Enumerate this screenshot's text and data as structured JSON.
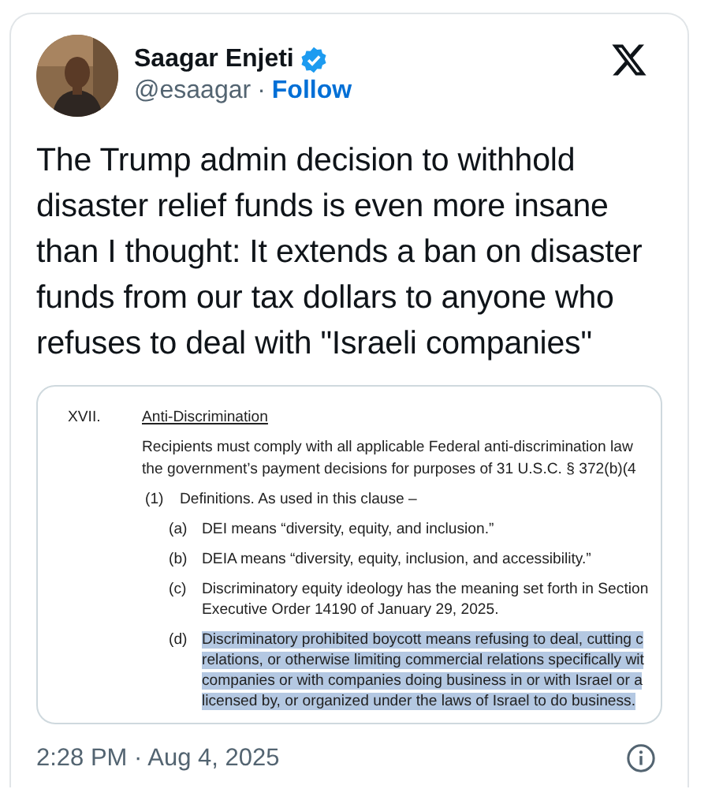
{
  "author": {
    "name": "Saagar Enjeti",
    "verified": true,
    "handle": "@esaagar",
    "separator": "·",
    "follow": "Follow"
  },
  "text": "The Trump admin decision to withhold disaster relief funds is even more insane than I thought: It extends a ban on disaster funds from our tax dollars to anyone who refuses to deal with \"Israeli companies\"",
  "document": {
    "section_number": "XVII.",
    "heading": "Anti-Discrimination",
    "intro_lines": [
      "Recipients must comply with all applicable Federal anti-discrimination law",
      "the government’s payment decisions for purposes of 31 U.S.C. § 372(b)(4"
    ],
    "items": [
      {
        "label": "(1)",
        "lines": [
          "Definitions. As used in this clause –"
        ],
        "highlighted": false,
        "children": [
          {
            "label": "(a)",
            "lines": [
              "DEI means “diversity, equity, and inclusion.”"
            ],
            "highlighted": false
          },
          {
            "label": "(b)",
            "lines": [
              "DEIA means “diversity, equity, inclusion, and accessibility.”"
            ],
            "highlighted": false
          },
          {
            "label": "(c)",
            "lines": [
              "Discriminatory equity ideology has the meaning set forth in Section",
              "Executive Order 14190 of January 29, 2025."
            ],
            "highlighted": false
          },
          {
            "label": "(d)",
            "lines": [
              "Discriminatory prohibited boycott means refusing to deal, cutting c",
              "relations, or otherwise limiting commercial relations specifically wit",
              "companies or with companies doing business in or with Israel or a",
              "licensed by, or organized under the laws of Israel to do business."
            ],
            "highlighted": true
          }
        ]
      }
    ]
  },
  "timestamp": "2:28 PM · Aug 4, 2025"
}
